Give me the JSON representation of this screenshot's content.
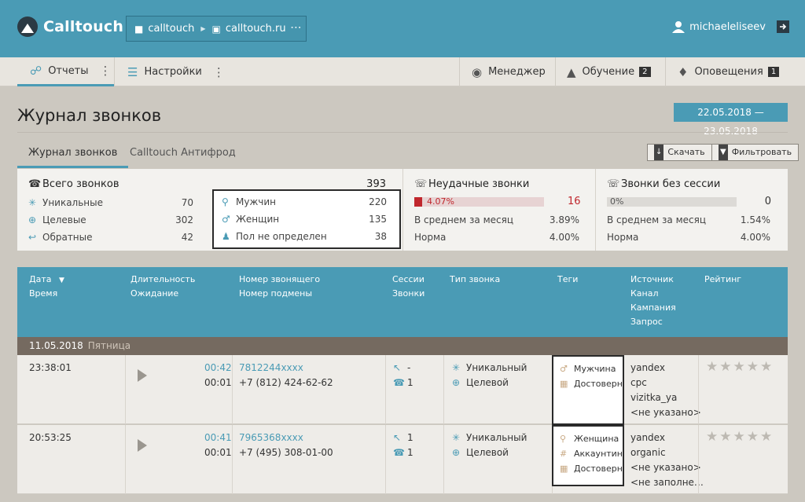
{
  "header": {
    "brand": "Calltouch",
    "crumb1": "calltouch",
    "crumb2": "calltouch.ru",
    "user": "michaeleliseev"
  },
  "nav": {
    "reports": "Отчеты",
    "settings": "Настройки",
    "manager": "Менеджер",
    "training": "Обучение",
    "training_badge": "2",
    "alerts": "Оповещения",
    "alerts_badge": "1"
  },
  "page": {
    "title": "Журнал звонков",
    "date_range": "22.05.2018 — 23.05.2018"
  },
  "tabs": {
    "journal": "Журнал звонков",
    "antifraud": "Calltouch Антифрод"
  },
  "toolbar": {
    "download": "Скачать",
    "filter": "Фильтровать"
  },
  "stats": {
    "total_label": "Всего звонков",
    "total": "393",
    "unique_label": "Уникальные",
    "unique": "70",
    "target_label": "Целевые",
    "target": "302",
    "back_label": "Обратные",
    "back": "42",
    "men_label": "Мужчин",
    "men": "220",
    "women_label": "Женщин",
    "women": "135",
    "unknown_label": "Пол не определен",
    "unknown": "38",
    "failed_label": "Неудачные звонки",
    "failed_pct": "4.07%",
    "failed_pct_num": 4.07,
    "failed": "16",
    "failed_avg_label": "В среднем за месяц",
    "failed_avg": "3.89%",
    "failed_norm_label": "Норма",
    "failed_norm": "4.00%",
    "nosession_label": "Звонки без сессии",
    "nosession_pct": "0%",
    "nosession": "0",
    "nosession_avg_label": "В среднем за месяц",
    "nosession_avg": "1.54%",
    "nosession_norm_label": "Норма",
    "nosession_norm": "4.00%"
  },
  "table": {
    "h_date": "Дата",
    "h_time": "Время",
    "h_duration": "Длительность",
    "h_wait": "Ожидание",
    "h_caller": "Номер звонящего",
    "h_subst": "Номер подмены",
    "h_sessions": "Сессии",
    "h_calls": "Звонки",
    "h_type": "Тип звонка",
    "h_tags": "Теги",
    "h_source": "Источник",
    "h_channel": "Канал",
    "h_campaign": "Кампания",
    "h_query": "Запрос",
    "h_rating": "Рейтинг"
  },
  "day": {
    "date": "11.05.2018",
    "weekday": "Пятница"
  },
  "rows": [
    {
      "time": "23:38:01",
      "duration": "00:42",
      "wait": "00:01",
      "caller": "7812244xxxx",
      "subst": "+7 (812) 424-62-62",
      "sessions": "-",
      "calls": "1",
      "type1": "Уникальный",
      "type2": "Целевой",
      "tag1": "Мужчина",
      "tag2": "Достоверн",
      "source": "yandex",
      "channel": "cpc",
      "campaign": "vizitka_ya",
      "query": "<не указано>",
      "stars": "★★★★★"
    },
    {
      "time": "20:53:25",
      "duration": "00:41",
      "wait": "00:01",
      "caller": "7965368xxxx",
      "subst": "+7 (495) 308-01-00",
      "sessions": "1",
      "calls": "1",
      "type1": "Уникальный",
      "type2": "Целевой",
      "tag1": "Женщина",
      "tag2": "Аккаунтинг",
      "tag3": "Достоверн",
      "source": "yandex",
      "channel": "organic",
      "campaign": "<не указано>",
      "query": "<не заполне…",
      "stars": "★★★★★"
    }
  ]
}
